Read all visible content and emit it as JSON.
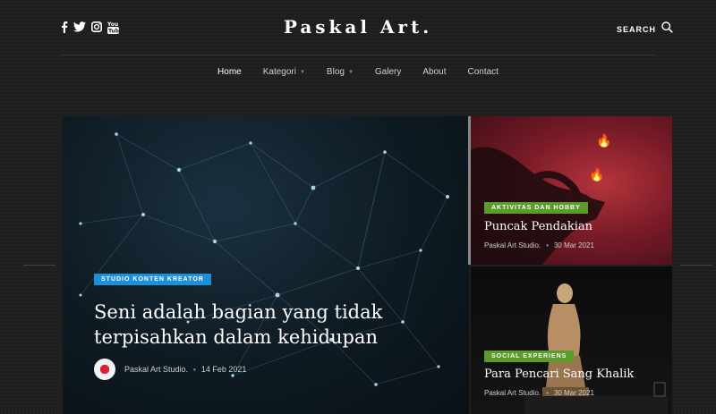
{
  "header": {
    "logo": "Paskal Art.",
    "search_label": "SEARCH",
    "social": [
      "facebook-icon",
      "twitter-icon",
      "instagram-icon",
      "youtube-icon"
    ]
  },
  "nav": {
    "items": [
      {
        "label": "Home",
        "active": true,
        "dropdown": false
      },
      {
        "label": "Kategori",
        "active": false,
        "dropdown": true
      },
      {
        "label": "Blog",
        "active": false,
        "dropdown": true
      },
      {
        "label": "Galery",
        "active": false,
        "dropdown": false
      },
      {
        "label": "About",
        "active": false,
        "dropdown": false
      },
      {
        "label": "Contact",
        "active": false,
        "dropdown": false
      }
    ]
  },
  "featured": {
    "category": "STUDIO KONTEN KREATOR",
    "title_line1": "Seni adalah bagian yang tidak",
    "title_line2": "terpisahkan dalam kehidupan",
    "author": "Paskal Art Studio.",
    "date": "14 Feb 2021",
    "category_color": "#1e90d8"
  },
  "side_posts": [
    {
      "category": "AKTIVITAS DAN HOBBY",
      "title": "Puncak Pendakian",
      "author": "Paskal Art Studio.",
      "date": "30 Mar 2021",
      "category_color": "#5b9b2a"
    },
    {
      "category": "SOCIAL EXPERIENS",
      "title": "Para Pencari Sang Khalik",
      "author": "Paskal Art Studio.",
      "date": "30 Mar 2021",
      "category_color": "#5b9b2a"
    }
  ]
}
